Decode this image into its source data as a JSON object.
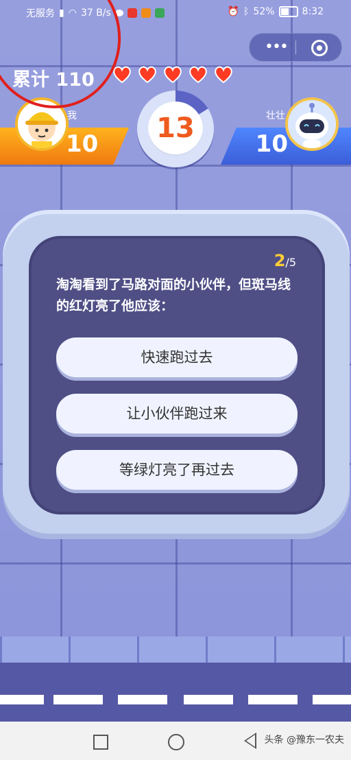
{
  "status_bar": {
    "carrier": "无服务",
    "net_speed": "37 B/s",
    "battery": "52%",
    "time": "8:32"
  },
  "capsule": {
    "more_icon": "more-dots-icon",
    "close_icon": "target-icon"
  },
  "header": {
    "total_label": "累计",
    "total_value": "110",
    "hearts": 5
  },
  "players": {
    "me": {
      "name": "我",
      "score": "10"
    },
    "opponent": {
      "name": "壮壮",
      "score": "10"
    }
  },
  "timer": {
    "seconds": "13",
    "remaining_fraction": 0.16
  },
  "question": {
    "current": "2",
    "total": "/5",
    "text": "淘淘看到了马路对面的小伙伴，但斑马线的红灯亮了他应该：",
    "options": [
      "快速跑过去",
      "让小伙伴跑过来",
      "等绿灯亮了再过去"
    ]
  },
  "watermark": "头条 @豫东一农夫",
  "colors": {
    "accent_orange": "#f07a10",
    "accent_blue": "#3b5ed8",
    "timer_number": "#ef5a1e",
    "card_bg": "#4f4f86",
    "heart_red": "#ff3b24"
  }
}
